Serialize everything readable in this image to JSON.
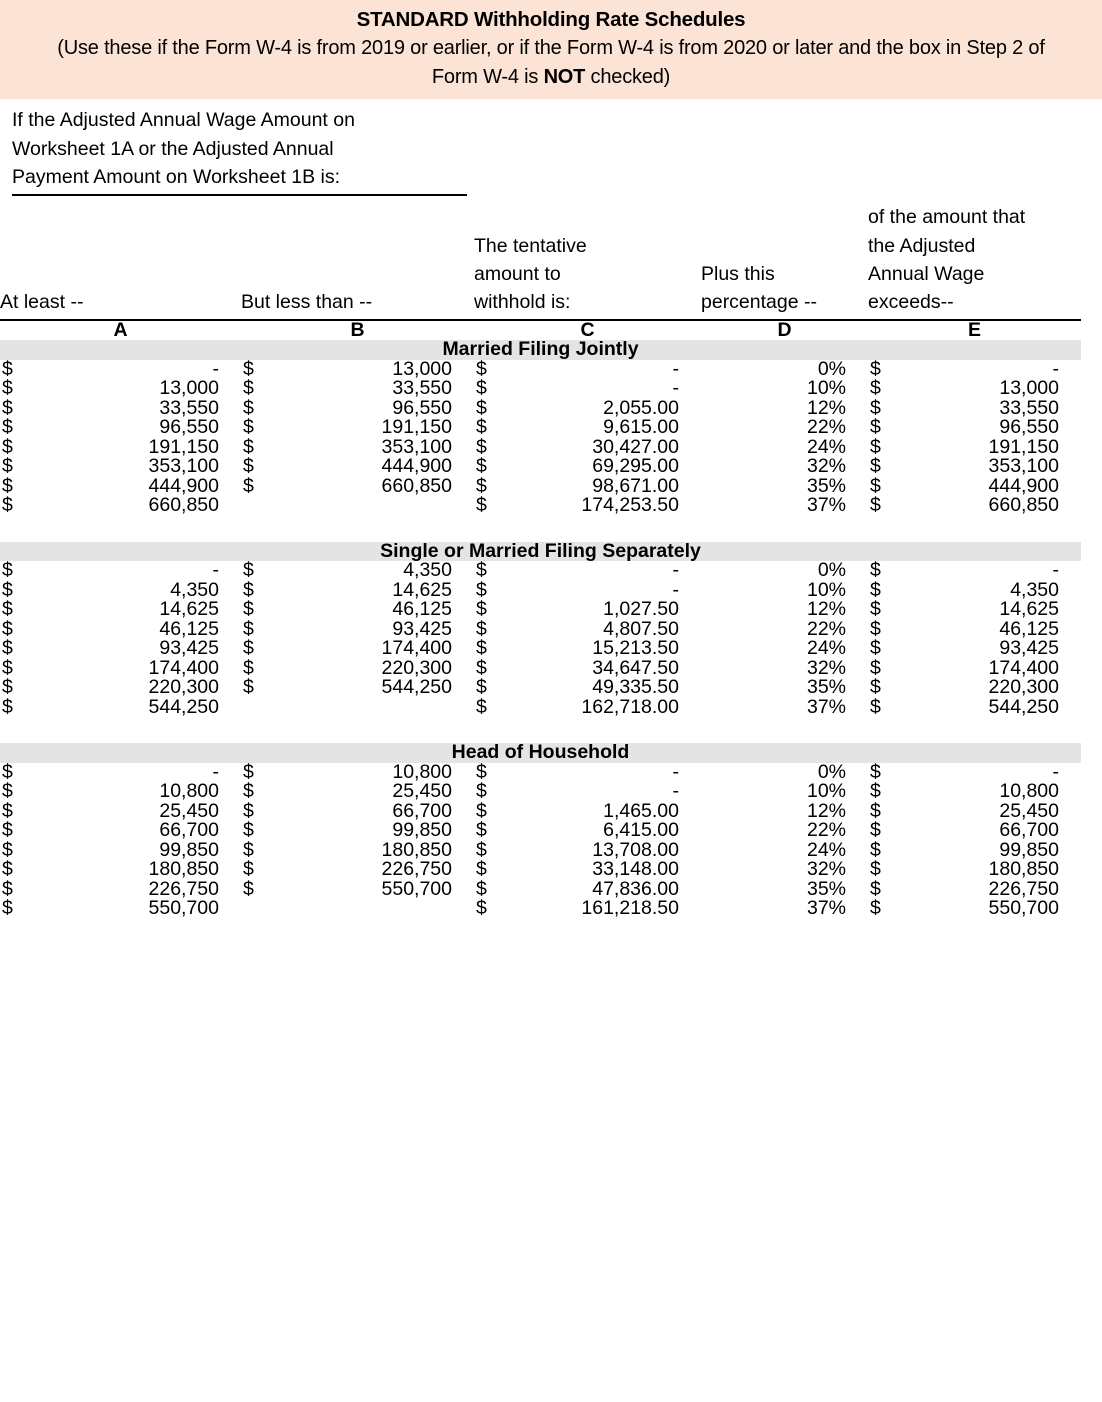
{
  "banner": {
    "title": "STANDARD Withholding Rate Schedules",
    "subtitle_line1": "(Use these if the Form W-4 is from 2019 or earlier, or if the Form W-4 is from 2020 or later and the",
    "subtitle_line2_pre": "box in Step 2 of Form W-4 is ",
    "subtitle_line2_bold": "NOT",
    "subtitle_line2_post": " checked)",
    "background_color": "#fbe3d5"
  },
  "intro": {
    "line1": "If the Adjusted Annual Wage Amount on",
    "line2": "Worksheet 1A or the Adjusted Annual",
    "line3": "Payment Amount on Worksheet 1B is:"
  },
  "headers": {
    "a": "At least --",
    "b": "But less than --",
    "c_line1": "The tentative",
    "c_line2": "amount to",
    "c_line3": "withhold is:",
    "d_line1": "Plus this",
    "d_line2": "percentage --",
    "e_line1": "of the amount that",
    "e_line2": "the Adjusted",
    "e_line3": "Annual Wage",
    "e_line4": "exceeds--"
  },
  "letters": {
    "a": "A",
    "b": "B",
    "c": "C",
    "d": "D",
    "e": "E"
  },
  "currency_symbol": "$",
  "band_color": "#e4e4e4",
  "sections": [
    {
      "title": "Married Filing Jointly",
      "rows": [
        {
          "a": "-",
          "b": "13,000",
          "c": "-",
          "d": "0%",
          "e": "-",
          "b_has_dollar": true,
          "e_has_dollar": true
        },
        {
          "a": "13,000",
          "b": "33,550",
          "c": "-",
          "d": "10%",
          "e": "13,000",
          "b_has_dollar": true,
          "e_has_dollar": true
        },
        {
          "a": "33,550",
          "b": "96,550",
          "c": "2,055.00",
          "d": "12%",
          "e": "33,550",
          "b_has_dollar": true,
          "e_has_dollar": true
        },
        {
          "a": "96,550",
          "b": "191,150",
          "c": "9,615.00",
          "d": "22%",
          "e": "96,550",
          "b_has_dollar": true,
          "e_has_dollar": true
        },
        {
          "a": "191,150",
          "b": "353,100",
          "c": "30,427.00",
          "d": "24%",
          "e": "191,150",
          "b_has_dollar": true,
          "e_has_dollar": true
        },
        {
          "a": "353,100",
          "b": "444,900",
          "c": "69,295.00",
          "d": "32%",
          "e": "353,100",
          "b_has_dollar": true,
          "e_has_dollar": true
        },
        {
          "a": "444,900",
          "b": "660,850",
          "c": "98,671.00",
          "d": "35%",
          "e": "444,900",
          "b_has_dollar": true,
          "e_has_dollar": true
        },
        {
          "a": "660,850",
          "b": "",
          "c": "174,253.50",
          "d": "37%",
          "e": "660,850",
          "b_has_dollar": false,
          "e_has_dollar": true
        }
      ]
    },
    {
      "title": "Single or Married Filing Separately",
      "rows": [
        {
          "a": "-",
          "b": "4,350",
          "c": "-",
          "d": "0%",
          "e": "-",
          "b_has_dollar": true,
          "e_has_dollar": true
        },
        {
          "a": "4,350",
          "b": "14,625",
          "c": "-",
          "d": "10%",
          "e": "4,350",
          "b_has_dollar": true,
          "e_has_dollar": true
        },
        {
          "a": "14,625",
          "b": "46,125",
          "c": "1,027.50",
          "d": "12%",
          "e": "14,625",
          "b_has_dollar": true,
          "e_has_dollar": true
        },
        {
          "a": "46,125",
          "b": "93,425",
          "c": "4,807.50",
          "d": "22%",
          "e": "46,125",
          "b_has_dollar": true,
          "e_has_dollar": true
        },
        {
          "a": "93,425",
          "b": "174,400",
          "c": "15,213.50",
          "d": "24%",
          "e": "93,425",
          "b_has_dollar": true,
          "e_has_dollar": true
        },
        {
          "a": "174,400",
          "b": "220,300",
          "c": "34,647.50",
          "d": "32%",
          "e": "174,400",
          "b_has_dollar": true,
          "e_has_dollar": true
        },
        {
          "a": "220,300",
          "b": "544,250",
          "c": "49,335.50",
          "d": "35%",
          "e": "220,300",
          "b_has_dollar": true,
          "e_has_dollar": true
        },
        {
          "a": "544,250",
          "b": "",
          "c": "162,718.00",
          "d": "37%",
          "e": "544,250",
          "b_has_dollar": false,
          "e_has_dollar": true
        }
      ]
    },
    {
      "title": "Head of Household",
      "rows": [
        {
          "a": "-",
          "b": "10,800",
          "c": "-",
          "d": "0%",
          "e": "-",
          "b_has_dollar": true,
          "e_has_dollar": true
        },
        {
          "a": "10,800",
          "b": "25,450",
          "c": "-",
          "d": "10%",
          "e": "10,800",
          "b_has_dollar": true,
          "e_has_dollar": true
        },
        {
          "a": "25,450",
          "b": "66,700",
          "c": "1,465.00",
          "d": "12%",
          "e": "25,450",
          "b_has_dollar": true,
          "e_has_dollar": true
        },
        {
          "a": "66,700",
          "b": "99,850",
          "c": "6,415.00",
          "d": "22%",
          "e": "66,700",
          "b_has_dollar": true,
          "e_has_dollar": true
        },
        {
          "a": "99,850",
          "b": "180,850",
          "c": "13,708.00",
          "d": "24%",
          "e": "99,850",
          "b_has_dollar": true,
          "e_has_dollar": true
        },
        {
          "a": "180,850",
          "b": "226,750",
          "c": "33,148.00",
          "d": "32%",
          "e": "180,850",
          "b_has_dollar": true,
          "e_has_dollar": true
        },
        {
          "a": "226,750",
          "b": "550,700",
          "c": "47,836.00",
          "d": "35%",
          "e": "226,750",
          "b_has_dollar": true,
          "e_has_dollar": true
        },
        {
          "a": "550,700",
          "b": "",
          "c": "161,218.50",
          "d": "37%",
          "e": "550,700",
          "b_has_dollar": false,
          "e_has_dollar": true
        }
      ]
    }
  ]
}
